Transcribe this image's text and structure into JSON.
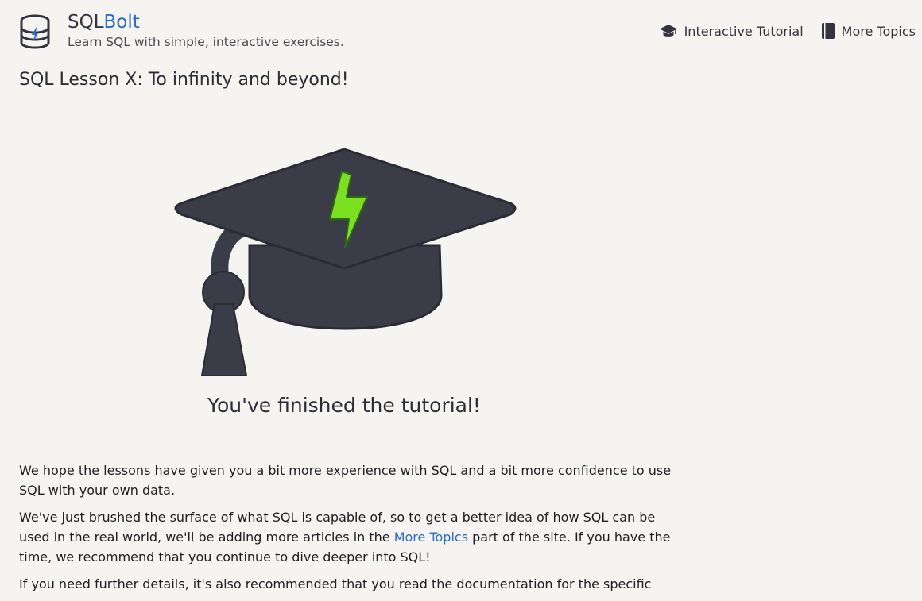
{
  "header": {
    "brand_prefix": "SQL",
    "brand_suffix": "Bolt",
    "tagline": "Learn SQL with simple, interactive exercises.",
    "nav": {
      "tutorial_label": "Interactive Tutorial",
      "topics_label": "More Topics"
    }
  },
  "lesson": {
    "title": "SQL Lesson X: To infinity and beyond!",
    "finished_caption": "You've finished the tutorial!"
  },
  "body": {
    "p1": "We hope the lessons have given you a bit more experience with SQL and a bit more confidence to use SQL with your own data.",
    "p2_before": "We've just brushed the surface of what SQL is capable of, so to get a better idea of how SQL can be used in the real world, we'll be adding more articles in the ",
    "p2_link": "More Topics",
    "p2_after": " part of the site. If you have the time, we recommend that you continue to dive deeper into SQL!",
    "p3": "If you need further details, it's also recommended that you read the documentation for the specific"
  },
  "colors": {
    "background": "#f5f4f0",
    "brand_accent": "#2a6bd2",
    "cap_dark": "#3a3d48",
    "bolt_green": "#7ae020"
  },
  "icons": {
    "logo": "database-bolt-icon",
    "tutorial": "graduation-cap-icon",
    "topics": "book-icon",
    "hero": "graduation-cap-bolt-illustration"
  }
}
